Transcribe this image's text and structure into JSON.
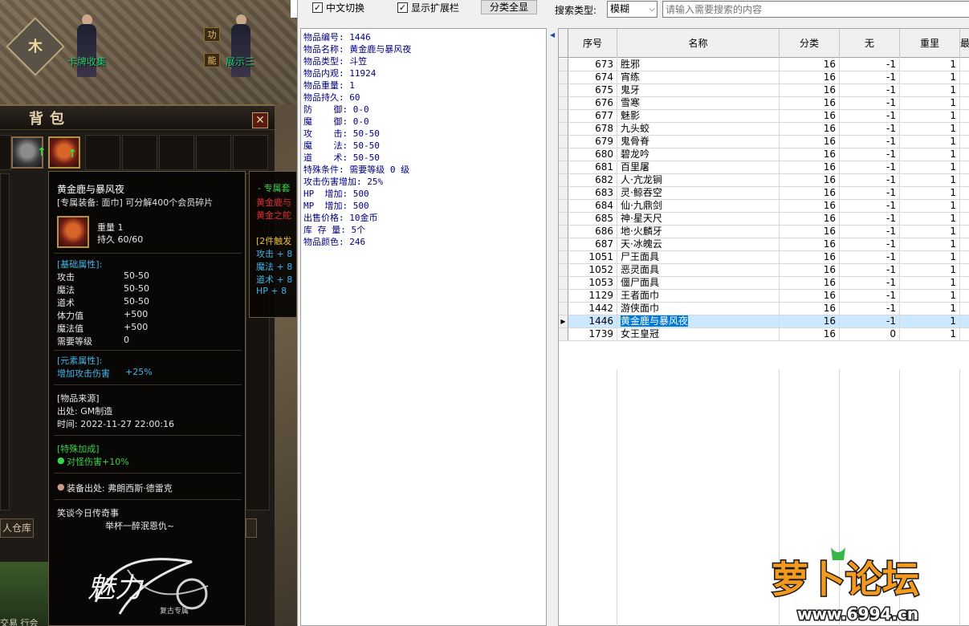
{
  "game": {
    "npc_left_name": "卡牌收集",
    "npc_right_name": "展示三",
    "sign_left": "功",
    "sign_right": "能",
    "rune_char": "木",
    "bag_title": "背包",
    "close_glyph": "✕",
    "warehouse_button": "人仓库",
    "bottom_text": "交易  行会"
  },
  "tooltip": {
    "title": "黄金鹿与暴风夜",
    "subtitle": "[专属装备: 面巾]   可分解400个会员碎片",
    "weight": "重量 1",
    "durability": "持久 60/60",
    "base_header": "[基础属性]:",
    "attrs": [
      {
        "name": "攻击",
        "value": "50-50"
      },
      {
        "name": "魔法",
        "value": "50-50"
      },
      {
        "name": "道术",
        "value": "50-50"
      },
      {
        "name": "体力值",
        "value": "+500"
      },
      {
        "name": "魔法值",
        "value": "+500"
      },
      {
        "name": "需要等级",
        "value": "0"
      }
    ],
    "element_header": "[元素属性]:",
    "element_attr": "增加攻击伤害",
    "element_value": "+25%",
    "source_header": "[物品来源]",
    "source_from": "出处: GM制造",
    "source_time": "时间: 2022-11-27 22:00:16",
    "special_header": "[特殊加成]",
    "special_attr": "对怪伤害+10%",
    "equip_source": "装备出处: 弗朗西斯·德雷克",
    "poem_1": "笑谈今日传奇事",
    "poem_2": "举杯一醉泯恩仇~",
    "logo_text": "魅力",
    "logo_sub": "复古专属"
  },
  "set_tip": {
    "title": "- 专属套",
    "line1": "黄金鹿与",
    "line2": "黄金之舵",
    "line3": "[2件触发",
    "line4": "攻击 + 8",
    "line5": "魔法 + 8",
    "line6": "道术 + 8",
    "line7": "HP  + 8"
  },
  "toolbar": {
    "cb_chinese": "中文切换",
    "cb_extend": "显示扩展栏",
    "btn_all": "分类全显",
    "search_type_label": "搜索类型:",
    "search_type_value": "模糊",
    "search_placeholder": "请输入需要搜索的内容"
  },
  "detail": {
    "lines": [
      "物品编号: 1446",
      "物品名称: 黄金鹿与暴风夜",
      "物品类型: 斗笠",
      "物品内观: 11924",
      "物品重量: 1",
      "物品持久: 60",
      "防    御: 0-0",
      "魔    御: 0-0",
      "攻    击: 50-50",
      "魔    法: 50-50",
      "道    术: 50-50",
      "特殊条件: 需要等级 0 级",
      "攻击伤害增加: 25%",
      "HP  增加: 500",
      "MP  增加: 500",
      "出售价格: 10金币",
      "库 存 量: 5个",
      "物品颜色: 246"
    ]
  },
  "grid": {
    "columns": [
      "序号",
      "名称",
      "分类",
      "无",
      "重里",
      "最"
    ],
    "rows": [
      {
        "id": "673",
        "name": "胜邪",
        "cat": "16",
        "none": "-1",
        "weight": "1"
      },
      {
        "id": "674",
        "name": "宵练",
        "cat": "16",
        "none": "-1",
        "weight": "1"
      },
      {
        "id": "675",
        "name": "鬼牙",
        "cat": "16",
        "none": "-1",
        "weight": "1"
      },
      {
        "id": "676",
        "name": "雪寒",
        "cat": "16",
        "none": "-1",
        "weight": "1"
      },
      {
        "id": "677",
        "name": "魅影",
        "cat": "16",
        "none": "-1",
        "weight": "1"
      },
      {
        "id": "678",
        "name": "九头蛟",
        "cat": "16",
        "none": "-1",
        "weight": "1"
      },
      {
        "id": "679",
        "name": "鬼骨脊",
        "cat": "16",
        "none": "-1",
        "weight": "1"
      },
      {
        "id": "680",
        "name": "碧龙吟",
        "cat": "16",
        "none": "-1",
        "weight": "1"
      },
      {
        "id": "681",
        "name": "百里屠",
        "cat": "16",
        "none": "-1",
        "weight": "1"
      },
      {
        "id": "682",
        "name": "人·亢龙锏",
        "cat": "16",
        "none": "-1",
        "weight": "1"
      },
      {
        "id": "683",
        "name": "灵·鲸吞空",
        "cat": "16",
        "none": "-1",
        "weight": "1"
      },
      {
        "id": "684",
        "name": "仙·九鼎剑",
        "cat": "16",
        "none": "-1",
        "weight": "1"
      },
      {
        "id": "685",
        "name": "神·星天尺",
        "cat": "16",
        "none": "-1",
        "weight": "1"
      },
      {
        "id": "686",
        "name": "地·火麟牙",
        "cat": "16",
        "none": "-1",
        "weight": "1"
      },
      {
        "id": "687",
        "name": "天·冰魄云",
        "cat": "16",
        "none": "-1",
        "weight": "1"
      },
      {
        "id": "1051",
        "name": "尸王面具",
        "cat": "16",
        "none": "-1",
        "weight": "1"
      },
      {
        "id": "1052",
        "name": "恶灵面具",
        "cat": "16",
        "none": "-1",
        "weight": "1"
      },
      {
        "id": "1053",
        "name": "僵尸面具",
        "cat": "16",
        "none": "-1",
        "weight": "1"
      },
      {
        "id": "1129",
        "name": "王者面巾",
        "cat": "16",
        "none": "-1",
        "weight": "1"
      },
      {
        "id": "1442",
        "name": "游侠面巾",
        "cat": "16",
        "none": "-1",
        "weight": "1"
      },
      {
        "id": "1446",
        "name": "黄金鹿与暴风夜",
        "cat": "16",
        "none": "-1",
        "weight": "1",
        "selected": true
      },
      {
        "id": "1739",
        "name": "女王皇冠",
        "cat": "16",
        "none": "0",
        "weight": "1"
      }
    ]
  },
  "watermark": {
    "title": "萝卜论坛",
    "url": "www.6994.cn"
  },
  "colors": {
    "selection": "#0078d7",
    "selection_row": "#cce8ff",
    "detail_text": "#000080",
    "tooltip_cyan": "#42b4e6",
    "tooltip_green": "#39d24a",
    "watermark_orange": "#f39a1e"
  }
}
